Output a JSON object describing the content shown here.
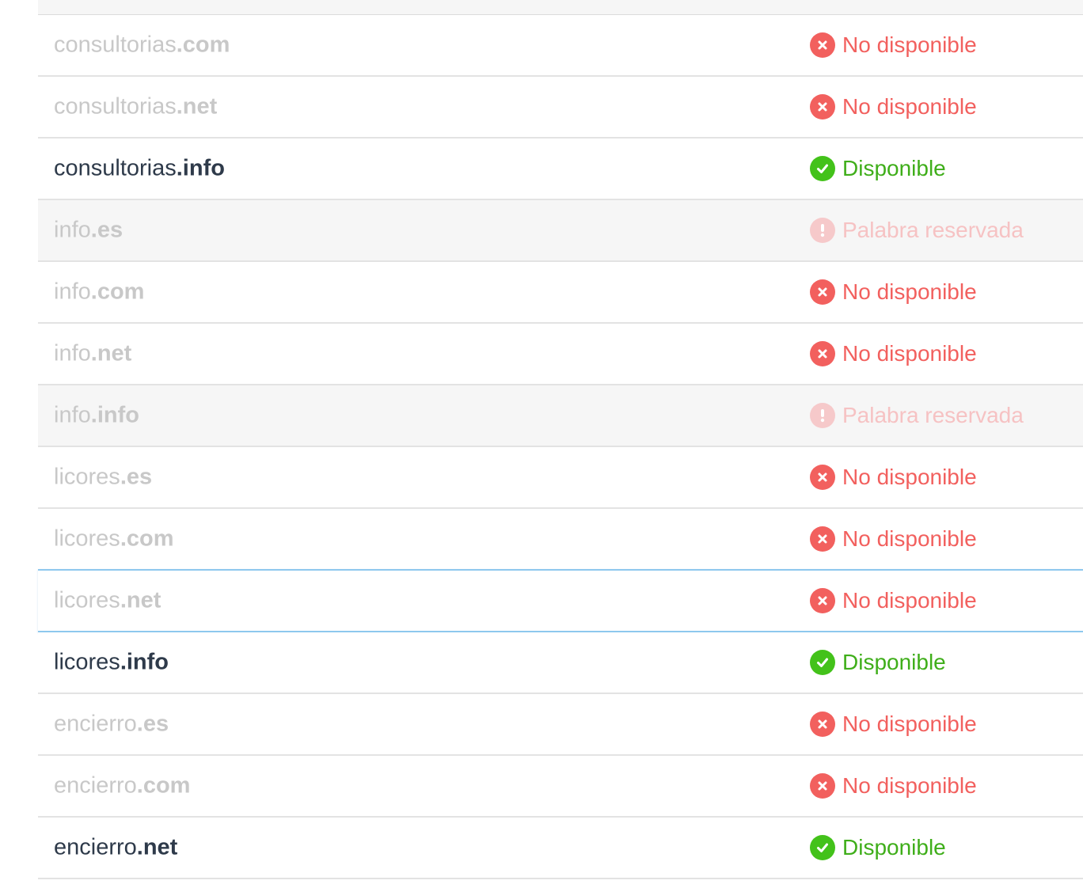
{
  "colors": {
    "unavailable": "#f2605e",
    "available": "#43c21a",
    "reserved": "#f6c9ca",
    "available_text": "#2e3a4a",
    "muted_text": "#c8c8c8",
    "highlight_border": "#8ec8ee"
  },
  "domains": [
    {
      "name": "consultorias",
      "tld": ".com",
      "status": "unavailable",
      "status_label": "No disponible",
      "icon": "x-circle-icon"
    },
    {
      "name": "consultorias",
      "tld": ".net",
      "status": "unavailable",
      "status_label": "No disponible",
      "icon": "x-circle-icon"
    },
    {
      "name": "consultorias",
      "tld": ".info",
      "status": "available",
      "status_label": "Disponible",
      "icon": "check-circle-icon"
    },
    {
      "name": "info",
      "tld": ".es",
      "status": "reserved",
      "status_label": "Palabra reservada",
      "icon": "exclamation-circle-icon"
    },
    {
      "name": "info",
      "tld": ".com",
      "status": "unavailable",
      "status_label": "No disponible",
      "icon": "x-circle-icon"
    },
    {
      "name": "info",
      "tld": ".net",
      "status": "unavailable",
      "status_label": "No disponible",
      "icon": "x-circle-icon"
    },
    {
      "name": "info",
      "tld": ".info",
      "status": "reserved",
      "status_label": "Palabra reservada",
      "icon": "exclamation-circle-icon"
    },
    {
      "name": "licores",
      "tld": ".es",
      "status": "unavailable",
      "status_label": "No disponible",
      "icon": "x-circle-icon"
    },
    {
      "name": "licores",
      "tld": ".com",
      "status": "unavailable",
      "status_label": "No disponible",
      "icon": "x-circle-icon"
    },
    {
      "name": "licores",
      "tld": ".net",
      "status": "unavailable",
      "status_label": "No disponible",
      "icon": "x-circle-icon",
      "highlighted": true
    },
    {
      "name": "licores",
      "tld": ".info",
      "status": "available",
      "status_label": "Disponible",
      "icon": "check-circle-icon"
    },
    {
      "name": "encierro",
      "tld": ".es",
      "status": "unavailable",
      "status_label": "No disponible",
      "icon": "x-circle-icon"
    },
    {
      "name": "encierro",
      "tld": ".com",
      "status": "unavailable",
      "status_label": "No disponible",
      "icon": "x-circle-icon"
    },
    {
      "name": "encierro",
      "tld": ".net",
      "status": "available",
      "status_label": "Disponible",
      "icon": "check-circle-icon"
    }
  ]
}
